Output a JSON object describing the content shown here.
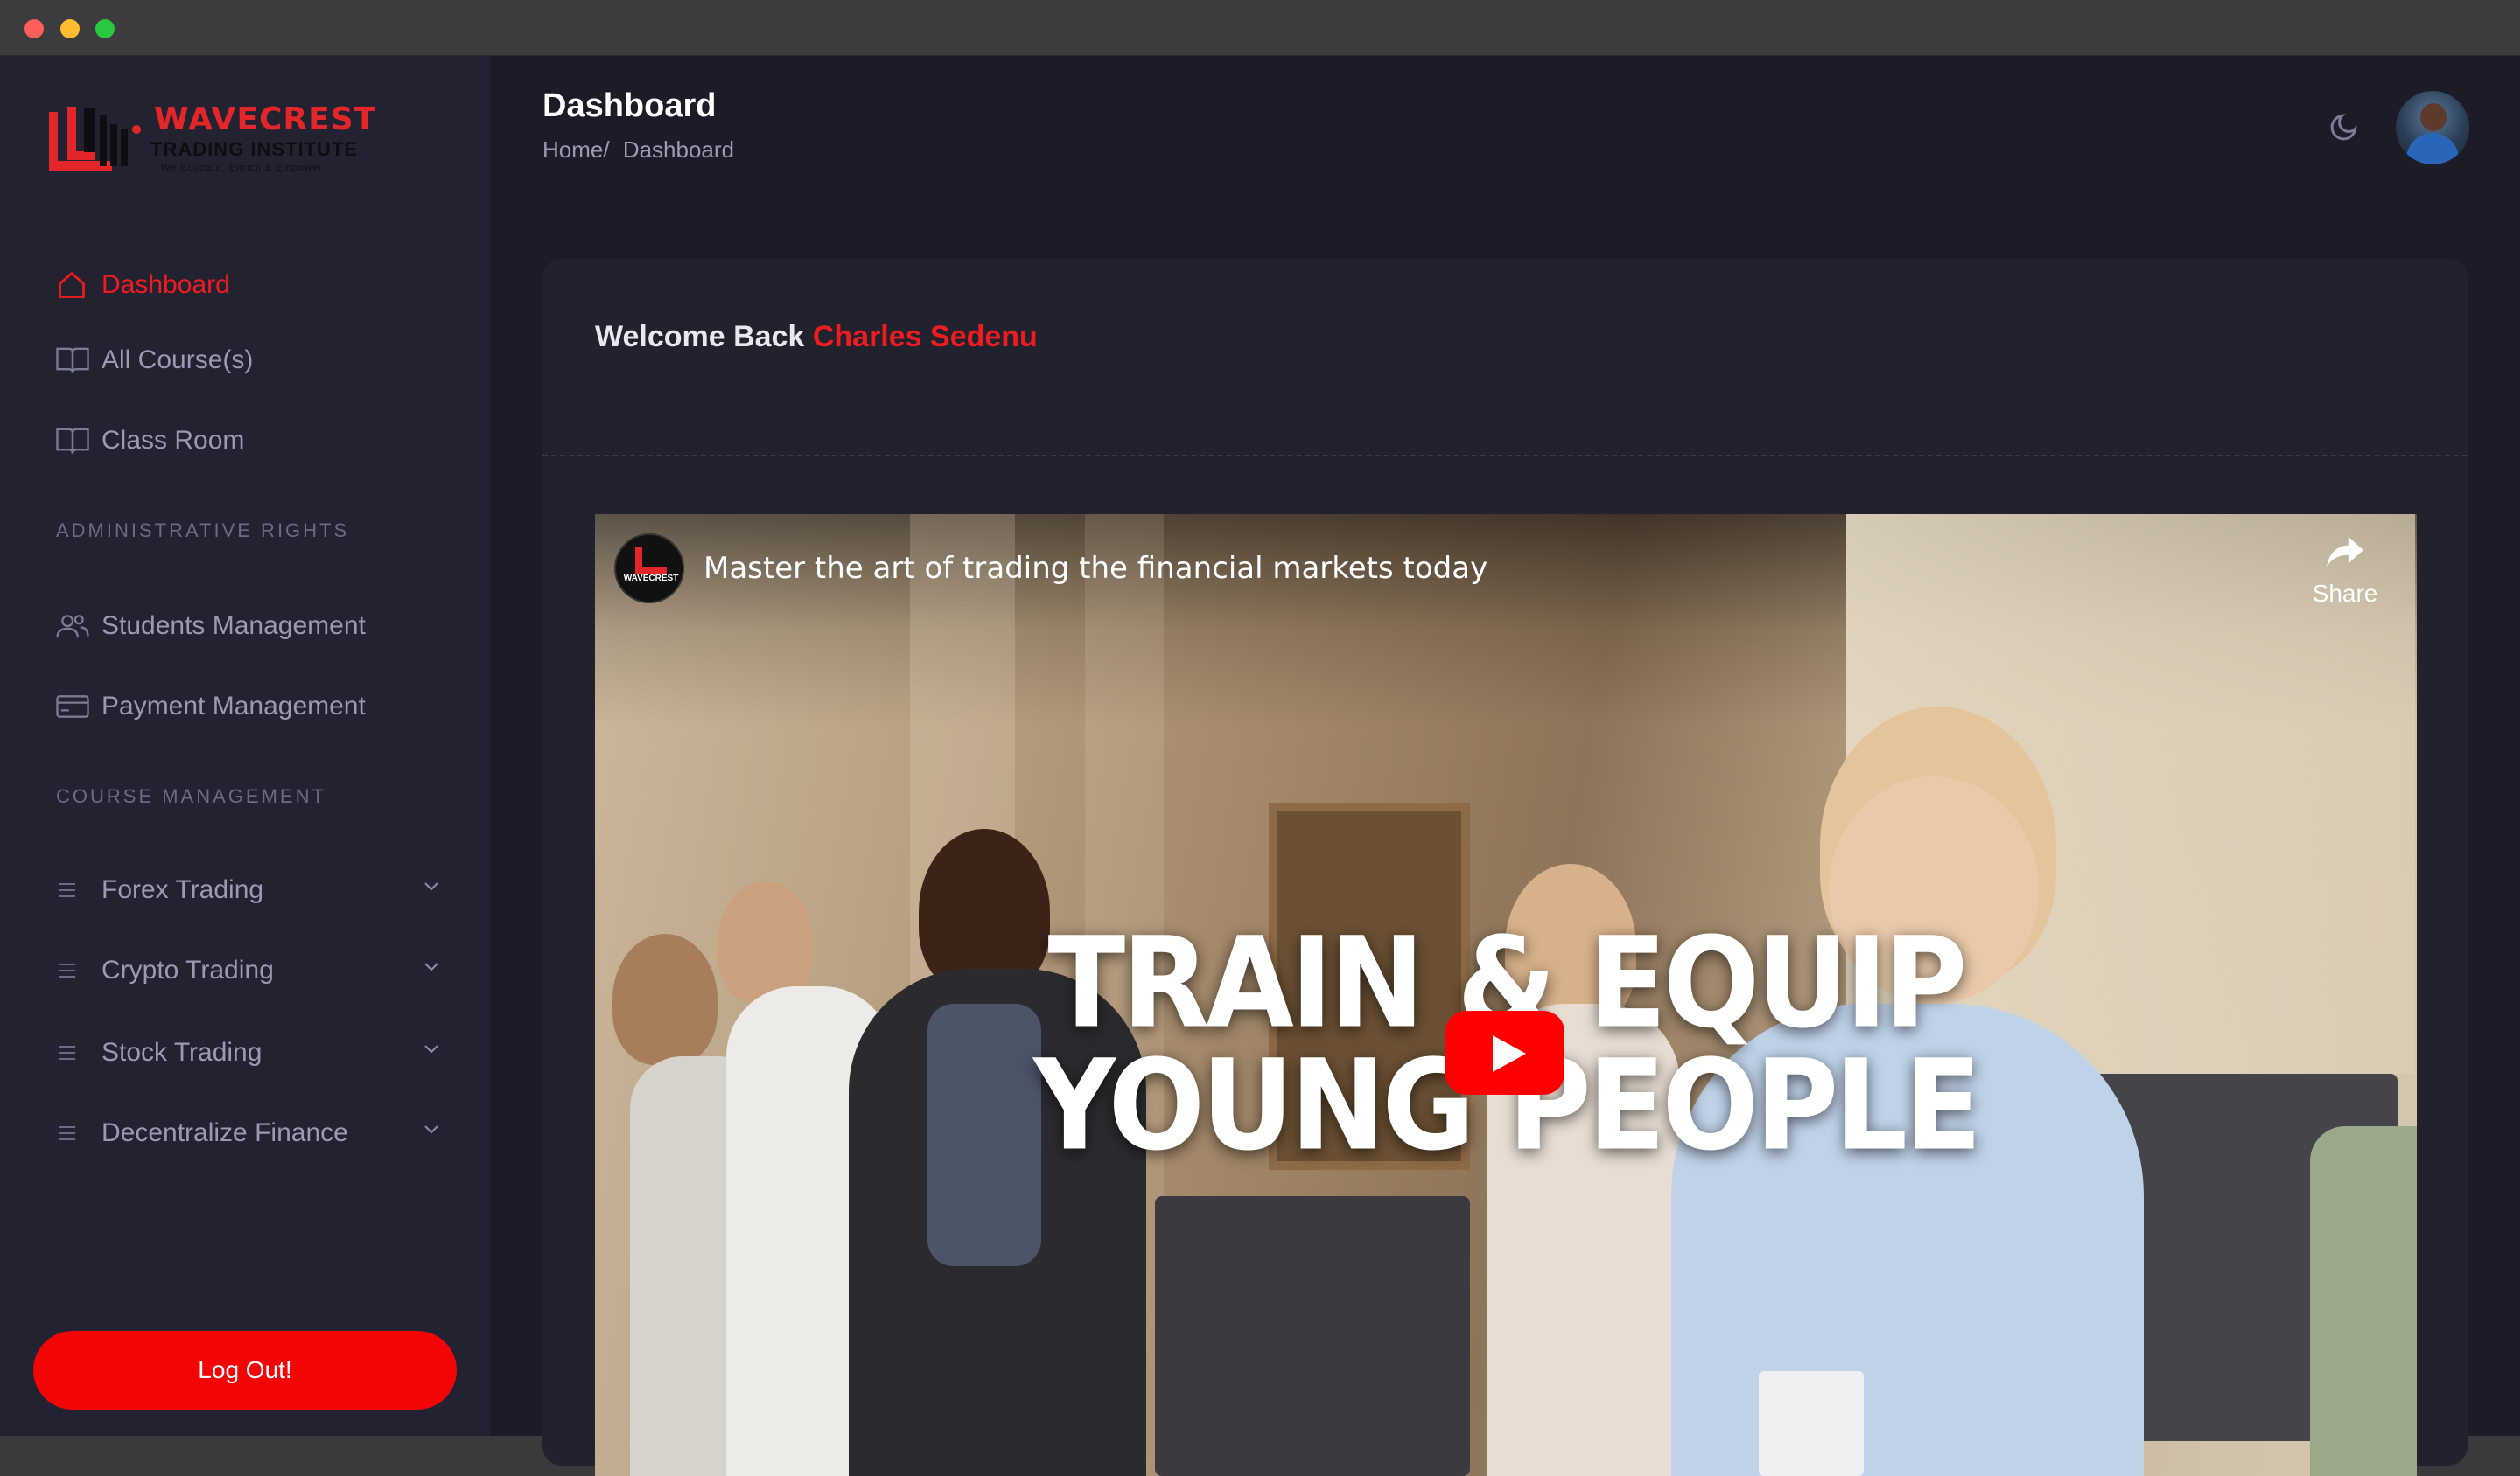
{
  "window": {
    "controls": [
      "close",
      "minimize",
      "maximize"
    ]
  },
  "brand": {
    "name": "WAVECREST",
    "subtitle": "TRADING INSTITUTE",
    "tagline": "We Educate, Enrich & Empower",
    "accent": "#ef1c1f"
  },
  "sidebar": {
    "main_items": [
      {
        "label": "Dashboard",
        "icon": "home-icon",
        "active": true
      },
      {
        "label": "All Course(s)",
        "icon": "book-icon",
        "active": false
      },
      {
        "label": "Class Room",
        "icon": "book-icon",
        "active": false
      }
    ],
    "admin_section": "ADMINISTRATIVE RIGHTS",
    "admin_items": [
      {
        "label": "Students Management",
        "icon": "users-icon"
      },
      {
        "label": "Payment Management",
        "icon": "credit-card-icon"
      }
    ],
    "course_section": "COURSE MANAGEMENT",
    "course_items": [
      {
        "label": "Forex Trading",
        "icon": "menu-icon"
      },
      {
        "label": "Crypto Trading",
        "icon": "menu-icon"
      },
      {
        "label": "Stock Trading",
        "icon": "menu-icon"
      },
      {
        "label": "Decentralize Finance",
        "icon": "menu-icon"
      }
    ],
    "logout_label": "Log Out!"
  },
  "header": {
    "title": "Dashboard",
    "breadcrumb": [
      "Home/",
      "Dashboard"
    ]
  },
  "welcome": {
    "prefix": "Welcome Back",
    "name": "Charles Sedenu"
  },
  "video": {
    "title": "Master the art of trading the financial markets today",
    "share_label": "Share",
    "channel_label": "WAVECREST",
    "overlay_line1": "TRAIN & EQUIP",
    "overlay_line2": "YOUNG PEOPLE"
  }
}
